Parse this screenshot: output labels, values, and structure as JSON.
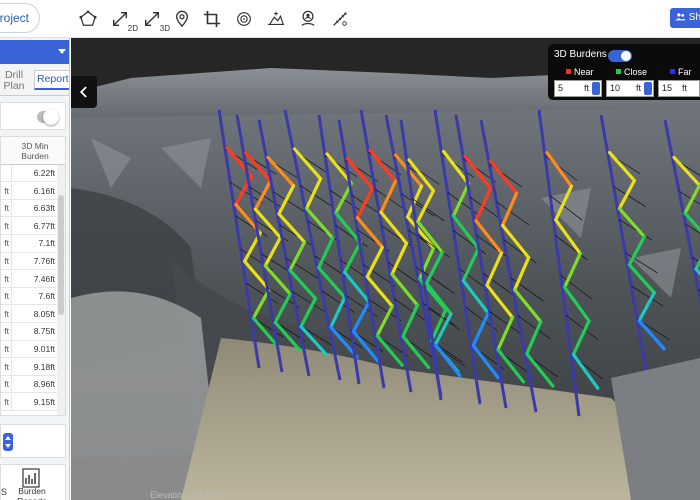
{
  "toolbar": {
    "project_label": "Project",
    "share_label": "Sh",
    "tools": [
      {
        "icon": "polygon-icon"
      },
      {
        "icon": "measure-2d-icon",
        "label": "2D"
      },
      {
        "icon": "measure-3d-icon",
        "label": "3D"
      },
      {
        "icon": "location-pin-icon"
      },
      {
        "icon": "crop-icon"
      },
      {
        "icon": "target-icon"
      },
      {
        "icon": "volume-icon"
      },
      {
        "icon": "person-pin-icon"
      },
      {
        "icon": "ruler-icon"
      }
    ]
  },
  "left_panel": {
    "tabs": [
      {
        "label": "Drill Plan"
      },
      {
        "label": "Report"
      }
    ],
    "table": {
      "header": "3D Min Burden",
      "rows": [
        {
          "c1": "",
          "value": "6.22ft"
        },
        {
          "c1": "ft",
          "value": "6.16ft"
        },
        {
          "c1": "ft",
          "value": "6.63ft"
        },
        {
          "c1": "ft",
          "value": "6.77ft"
        },
        {
          "c1": "ft",
          "value": "7.1ft"
        },
        {
          "c1": "ft",
          "value": "7.76ft"
        },
        {
          "c1": "ft",
          "value": "7.46ft"
        },
        {
          "c1": "ft",
          "value": "7.6ft"
        },
        {
          "c1": "ft",
          "value": "8.05ft"
        },
        {
          "c1": "ft",
          "value": "8.75ft"
        },
        {
          "c1": "ft",
          "value": "9.01ft"
        },
        {
          "c1": "ft",
          "value": "9.18ft"
        },
        {
          "c1": "ft",
          "value": "8.96ft"
        },
        {
          "c1": "ft",
          "value": "9.15ft"
        }
      ]
    },
    "reports": {
      "count_label": "S",
      "burden_reports_label": "Burden Reports"
    }
  },
  "burdens_panel": {
    "title": "3D Burdens",
    "enabled": true,
    "legend": [
      {
        "label": "Near",
        "color": "#ff2a2a"
      },
      {
        "label": "Close",
        "color": "#22cc33"
      },
      {
        "label": "Far",
        "color": "#2a2aff"
      }
    ],
    "fields": [
      {
        "value": "5",
        "unit": "ft"
      },
      {
        "value": "10",
        "unit": "ft"
      },
      {
        "value": "15",
        "unit": "ft"
      }
    ]
  },
  "viewport": {
    "scale_text": "Elevation: 04 18ft"
  }
}
